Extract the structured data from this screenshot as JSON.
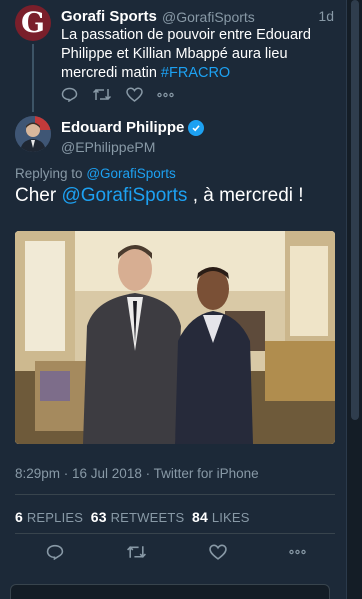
{
  "tweet1": {
    "avatar_letter": "G",
    "name": "Gorafi Sports",
    "handle": "@GorafiSports",
    "time": "1d",
    "text_before": "La passation de pouvoir entre Edouard Philippe et Killian Mbappé aura lieu mercredi matin ",
    "hashtag": "#FRACRO"
  },
  "tweet2": {
    "name": "Edouard Philippe",
    "handle": "@EPhilippePM",
    "replying_label": "Replying to",
    "replying_handle": "@GorafiSports",
    "text_before": "Cher ",
    "mention": "@GorafiSports",
    "text_after": " , à mercredi !",
    "meta": "8:29pm · 16 Jul 2018 · Twitter for iPhone",
    "replies_count": "6",
    "replies_label": "REPLIES",
    "retweets_count": "63",
    "retweets_label": "RETWEETS",
    "likes_count": "84",
    "likes_label": "LIKES"
  },
  "colors": {
    "background": "#141d26",
    "card": "#1c2938",
    "link": "#1da1f2",
    "muted": "#8899a6"
  },
  "icons": [
    "reply-icon",
    "retweet-icon",
    "like-icon",
    "more-icon",
    "verified-icon"
  ]
}
